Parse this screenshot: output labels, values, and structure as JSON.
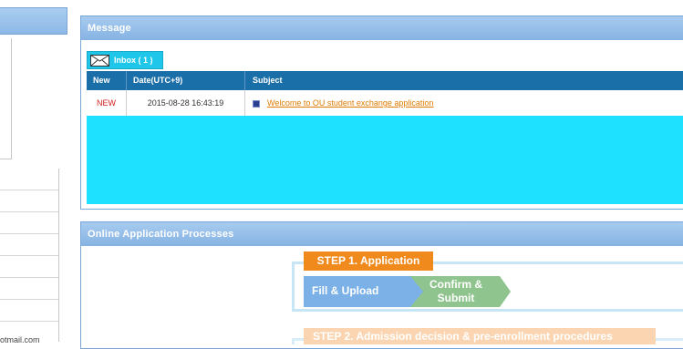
{
  "left": {
    "partial_email": "otmail.com"
  },
  "message_panel": {
    "title": "Message",
    "inbox_tab": "Inbox ( 1 )",
    "columns": [
      "New",
      "Date(UTC+9)",
      "Subject"
    ],
    "rows": [
      {
        "new": "NEW",
        "date": "2015-08-28 16:43:19",
        "subject": "Welcome to OU student exchange application"
      }
    ]
  },
  "process_panel": {
    "title": "Online Application Processes",
    "step1": "STEP 1. Application",
    "step1_items": [
      "Fill & Upload",
      "Confirm & Submit"
    ],
    "step2": "STEP 2. Admission decision & pre-enrollment procedures"
  },
  "colors": {
    "panel_header": "#8db8e6",
    "inbox_cyan": "#1ee1ff",
    "table_header": "#1b6fa8",
    "step_orange": "#f08a1c",
    "fill_blue": "#7bb1e6",
    "confirm_green": "#8fc48e"
  }
}
